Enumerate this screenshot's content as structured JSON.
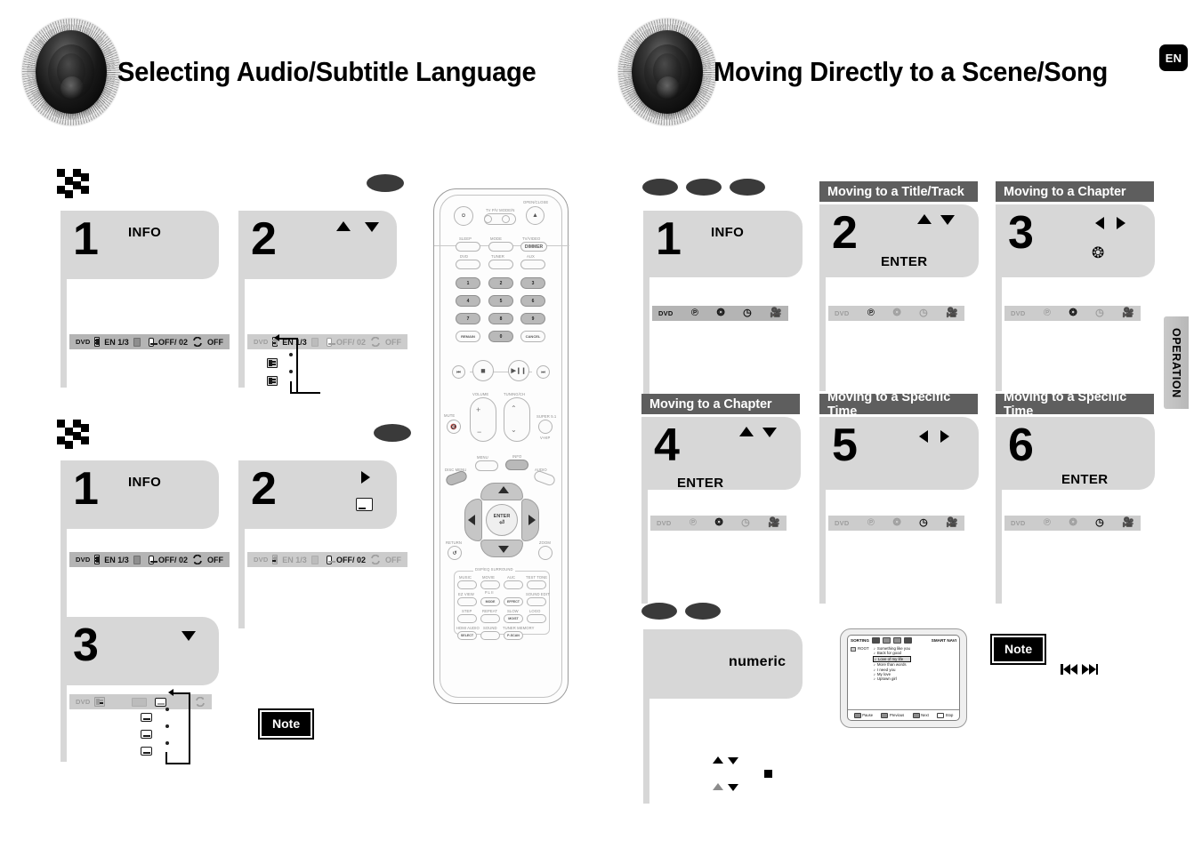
{
  "page": {
    "language_badge": "EN",
    "side_tab": "OPERATION"
  },
  "left_section": {
    "title": "Selecting Audio/Subtitle Language",
    "speaker_icon": "speaker-cone-icon",
    "audio_group": {
      "marker": "checker-arrow-marker",
      "disc_badges": [
        "dvd-badge"
      ],
      "steps": [
        {
          "number": "1",
          "label": "INFO",
          "arrows": []
        },
        {
          "number": "2",
          "label": "",
          "arrows": [
            "up",
            "down"
          ]
        }
      ],
      "osd_bar": {
        "disc": "DVD",
        "audio_icon": "audio-language-icon",
        "audio_value": "EN 1/3",
        "sound_icon": "digital-sound-icon",
        "subtitle_icon": "subtitle-icon",
        "subtitle_value": "OFF/ 02",
        "repeat_icon": "repeat-icon",
        "repeat_value": "OFF"
      },
      "cycle_items": [
        "audio-language-icon",
        "audio-language-icon"
      ]
    },
    "subtitle_group": {
      "marker": "checker-arrow-marker",
      "disc_badges": [
        "dvd-badge"
      ],
      "steps": [
        {
          "number": "1",
          "label": "INFO",
          "arrows": []
        },
        {
          "number": "2",
          "label": "",
          "arrows": [
            "right"
          ],
          "icon": "subtitle-icon"
        },
        {
          "number": "3",
          "label": "",
          "arrows": [
            "down"
          ]
        }
      ],
      "osd_bar": {
        "disc": "DVD",
        "audio_icon": "audio-language-icon",
        "audio_value": "EN 1/3",
        "sound_icon": "digital-sound-icon",
        "subtitle_icon": "subtitle-icon",
        "subtitle_value": "OFF/ 02",
        "repeat_icon": "repeat-icon",
        "repeat_value": "OFF"
      },
      "cycle_items": [
        "subtitle-icon",
        "subtitle-icon",
        "subtitle-icon"
      ],
      "note_label": "Note"
    }
  },
  "remote": {
    "name": "remote-control-diagram",
    "top": {
      "power": "power-button",
      "tv_pv_label": "TV  P/V MODE/N",
      "open_close": "OPEN/CLOSE",
      "eject_icon": "eject-icon"
    },
    "mode_row": [
      "SLEEP",
      "MODE",
      "TV/VIDEO"
    ],
    "dimmer": "DIMMER",
    "source_row": [
      "DVD",
      "TUNER",
      "AUX"
    ],
    "keypad": [
      "1",
      "2",
      "3",
      "4",
      "5",
      "6",
      "7",
      "8",
      "9"
    ],
    "keypad_bottom": [
      "REMAIN",
      "0",
      "CANCEL"
    ],
    "transport": [
      "skip-back-icon",
      "stop-icon",
      "play-pause-icon",
      "skip-forward-icon"
    ],
    "volume_label": "VOLUME",
    "tuning_label": "TUNING/CH",
    "mute_label": "MUTE",
    "super_label": "SUPER 5.1",
    "vhip_label": "V-HIP",
    "menu_label": "MENU",
    "info_label": "INFO",
    "disc_menu_label": "DISC MENU",
    "audio_label": "AUDIO",
    "enter_label": "ENTER",
    "return_label": "RETURN",
    "zoom_label": "ZOOM",
    "surround_group_label": "DSP/EQ SURROUND",
    "fn_rows": [
      [
        "MUSIC",
        "MOVIE",
        "AUC",
        "TEST TONE"
      ],
      [
        "EZ VIEW",
        "MODE",
        "EFFECT",
        "SOUND EDIT"
      ],
      [
        "STEP",
        "REPEAT",
        "SLOW",
        "LOGO"
      ],
      [
        "HDMI AUDIO",
        "SOUND",
        "TUNER MEMORY"
      ]
    ],
    "fn_sub_labels": [
      "P.L II",
      "MO/ST",
      "SELECT",
      "P-SCAN"
    ]
  },
  "right_section": {
    "title": "Moving Directly to a Scene/Song",
    "speaker_icon": "speaker-cone-icon",
    "group_a": {
      "disc_badges": [
        "dvd-badge",
        "vcd-badge",
        "cd-badge"
      ],
      "steps": [
        {
          "number": "1",
          "label": "INFO",
          "header": "",
          "arrows": []
        },
        {
          "number": "2",
          "label": "ENTER",
          "header": "Moving to a Title/Track",
          "arrows": [
            "up",
            "down"
          ]
        },
        {
          "number": "3",
          "label": "",
          "header": "Moving to a Chapter",
          "arrows": [
            "left",
            "right"
          ],
          "icon": "chapter-icon"
        },
        {
          "number": "4",
          "label": "ENTER",
          "header": "Moving to a Chapter",
          "arrows": [
            "up",
            "down"
          ]
        },
        {
          "number": "5",
          "label": "",
          "header": "Moving to a Specific Time",
          "arrows": [
            "left",
            "right"
          ]
        },
        {
          "number": "6",
          "label": "ENTER",
          "header": "Moving to a Specific Time",
          "arrows": []
        }
      ],
      "osd_bar": {
        "disc": "DVD",
        "title_icon": "title-icon",
        "chapter_icon": "chapter-icon",
        "time_icon": "time-icon",
        "camera_icon": "camera-angle-icon"
      }
    },
    "group_b": {
      "disc_badges": [
        "vcd-badge",
        "cd-badge"
      ],
      "step": {
        "number": "",
        "label": "numeric"
      },
      "note_label": "Note",
      "skip_icons": [
        "skip-back-icon",
        "skip-forward-icon"
      ],
      "stop_icon": "stop-square-icon"
    },
    "smart_navi": {
      "header_label": "SORTING",
      "smart_label": "SMART NAVI",
      "root_label": "ROOT",
      "sort_chips": [
        "note-chip",
        "person-chip",
        "album-chip",
        "all-chip"
      ],
      "songs": [
        "Something like you",
        "Back for good",
        "Love of my life",
        "More than words",
        "I need you",
        "My love",
        "Uptown girl"
      ],
      "selected_song_index": 2,
      "footer_buttons": [
        "Pause",
        "Previous",
        "Next",
        "Stop"
      ]
    }
  }
}
